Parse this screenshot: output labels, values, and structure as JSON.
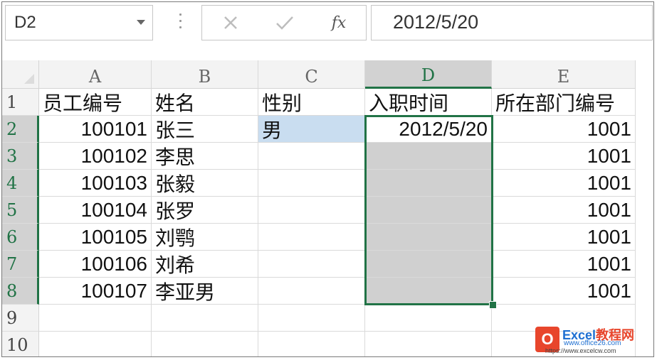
{
  "formula_bar": {
    "name_box": "D2",
    "fx_label": "fx",
    "formula_value": "2012/5/20"
  },
  "columns": [
    "A",
    "B",
    "C",
    "D",
    "E"
  ],
  "selected_column": "D",
  "rows": [
    "1",
    "2",
    "3",
    "4",
    "5",
    "6",
    "7",
    "8",
    "9",
    "10"
  ],
  "selected_rows": [
    "2",
    "3",
    "4",
    "5",
    "6",
    "7",
    "8"
  ],
  "cells": {
    "A1": "员工编号",
    "B1": "姓名",
    "C1": "性别",
    "D1": "入职时间",
    "E1": "所在部门编号",
    "A2": "100101",
    "B2": "张三",
    "C2": "男",
    "D2": "2012/5/20",
    "E2": "1001",
    "A3": "100102",
    "B3": "李思",
    "E3": "1001",
    "A4": "100103",
    "B4": "张毅",
    "E4": "1001",
    "A5": "100104",
    "B5": "张罗",
    "E5": "1001",
    "A6": "100105",
    "B6": "刘鹗",
    "E6": "1001",
    "A7": "100106",
    "B7": "刘希",
    "E7": "1001",
    "A8": "100107",
    "B8": "李亚男",
    "E8": "1001"
  },
  "watermark": {
    "logo_letter": "O",
    "title_a": "Excel",
    "title_b": "教程网",
    "sub": "www.office26.com",
    "url": "https://www.excelcw.com"
  },
  "colors": {
    "accent_green": "#217346",
    "highlight_blue": "#c9ddf0",
    "selection_gray": "#d0d0d0"
  }
}
